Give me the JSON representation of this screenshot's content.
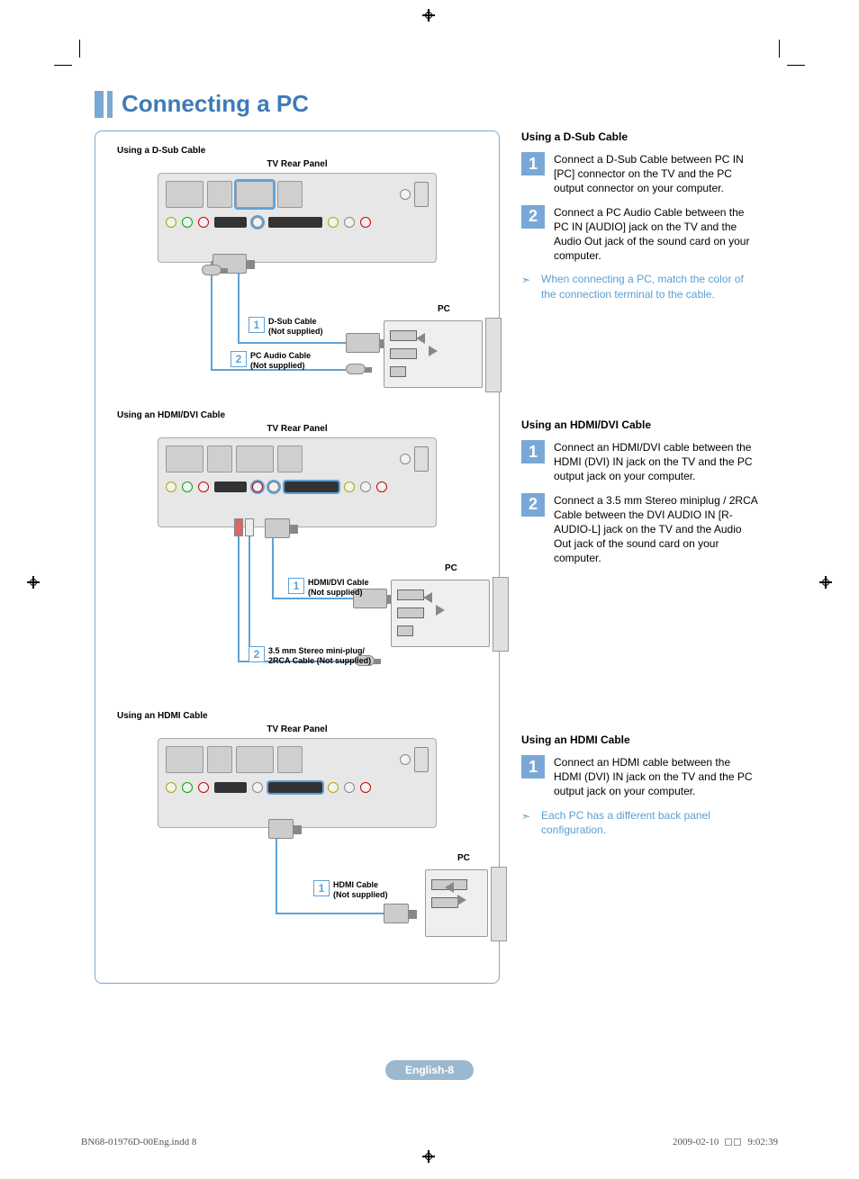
{
  "title": "Connecting a PC",
  "page_badge": "English-8",
  "footer": {
    "file": "BN68-01976D-00Eng.indd   8",
    "date": "2009-02-10",
    "time": "9:02:39"
  },
  "diagrams": {
    "dsub": {
      "section": "Using a D-Sub Cable",
      "panel": "TV Rear Panel",
      "pc": "PC",
      "cable1_num": "1",
      "cable1": "D-Sub Cable\n(Not supplied)",
      "cable2_num": "2",
      "cable2": "PC Audio Cable\n(Not supplied)"
    },
    "hdmi_dvi": {
      "section": "Using an HDMI/DVI Cable",
      "panel": "TV Rear Panel",
      "pc": "PC",
      "cable1_num": "1",
      "cable1": "HDMI/DVI Cable\n(Not supplied)",
      "cable2_num": "2",
      "cable2": "3.5 mm Stereo mini-plug/\n2RCA Cable (Not supplied)"
    },
    "hdmi": {
      "section": "Using an HDMI Cable",
      "panel": "TV Rear Panel",
      "pc": "PC",
      "cable1_num": "1",
      "cable1": "HDMI Cable\n(Not supplied)"
    }
  },
  "right": {
    "dsub": {
      "heading": "Using a D-Sub Cable",
      "steps": [
        {
          "n": "1",
          "t": "Connect a D-Sub Cable between PC IN [PC] connector on the TV and the PC output connector on your computer."
        },
        {
          "n": "2",
          "t": "Connect a PC Audio Cable between the PC IN [AUDIO] jack on the TV and the Audio Out jack of the sound card on your computer."
        }
      ],
      "note": "When connecting a PC, match the color of the connection terminal to the cable."
    },
    "hdmi_dvi": {
      "heading": "Using an HDMI/DVI Cable",
      "steps": [
        {
          "n": "1",
          "t": "Connect an HDMI/DVI cable between the HDMI (DVI) IN jack on the TV and the PC output jack on your computer."
        },
        {
          "n": "2",
          "t": "Connect a 3.5 mm Stereo miniplug / 2RCA Cable between the DVI AUDIO IN [R-AUDIO-L] jack on the TV and the Audio Out jack of the sound card on your computer."
        }
      ]
    },
    "hdmi": {
      "heading": "Using an HDMI Cable",
      "steps": [
        {
          "n": "1",
          "t": "Connect an HDMI cable between the HDMI (DVI) IN jack on the TV and the PC output jack on your computer."
        }
      ],
      "note": "Each PC has a different back panel configuration."
    }
  }
}
